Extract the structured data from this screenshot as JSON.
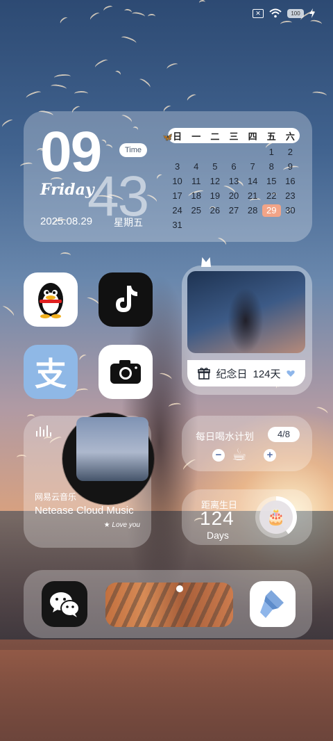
{
  "status_bar": {
    "sim_icon": "sim-off-icon",
    "sim_glyph": "✕",
    "wifi_icon": "wifi-icon",
    "battery_text": "100",
    "charging_icon": "lightning-icon"
  },
  "clock_widget": {
    "hour": "09",
    "minute": "43",
    "day_name": "Friday",
    "time_bubble": "Time",
    "date": "2025.08.29",
    "weekday": "星期五"
  },
  "calendar": {
    "headers": [
      "日",
      "一",
      "二",
      "三",
      "四",
      "五",
      "六"
    ],
    "days": [
      "",
      "",
      "",
      "",
      "",
      "1",
      "2",
      "3",
      "4",
      "5",
      "6",
      "7",
      "8",
      "9",
      "10",
      "11",
      "12",
      "13",
      "14",
      "15",
      "16",
      "17",
      "18",
      "19",
      "20",
      "21",
      "22",
      "23",
      "24",
      "25",
      "26",
      "27",
      "28",
      "29",
      "30",
      "31"
    ],
    "today": "29",
    "highlight_color": "#f2a487"
  },
  "apps": {
    "qq_icon": "qq-penguin-icon",
    "tiktok_icon": "tiktok-icon",
    "alipay_icon": "alipay-icon",
    "alipay_glyph": "支",
    "camera_icon": "camera-icon"
  },
  "photo_widget": {
    "anniversary_label": "纪念日",
    "anniversary_days": "124天",
    "gift_icon": "gift-icon",
    "heart_icon": "heart-icon"
  },
  "music_widget": {
    "title_cn": "网易云音乐",
    "title_en": "Netease Cloud Music",
    "tagline": "Love you"
  },
  "water_widget": {
    "title": "每日喝水计划",
    "count": "4/8",
    "minus": "−",
    "plus": "+",
    "cup_icon": "coffee-cup-icon"
  },
  "birthday_widget": {
    "label": "距离生日",
    "days": "124",
    "unit": "Days",
    "cake_icon": "birthday-cake-icon",
    "progress": 0.4
  },
  "dock": {
    "wechat_icon": "wechat-icon",
    "brush_icon": "paint-brush-icon"
  }
}
